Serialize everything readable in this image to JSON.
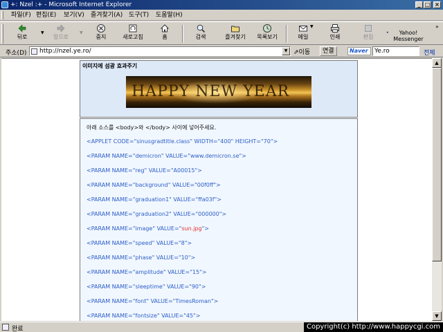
{
  "window": {
    "title": "+: Nzel :+ - Microsoft Internet Explorer",
    "controls": [
      "_",
      "□",
      "×"
    ]
  },
  "menu": [
    "파일(F)",
    "편집(E)",
    "보기(V)",
    "즐겨찾기(A)",
    "도구(T)",
    "도움말(H)"
  ],
  "toolbar": {
    "back": "뒤로",
    "forward": "앞으로",
    "stop": "중지",
    "refresh": "새로고침",
    "home": "홈",
    "search": "검색",
    "favorites": "즐겨찾기",
    "history": "목록보기",
    "mail": "메일",
    "print": "인쇄",
    "edit": "편집",
    "messenger": "Yahoo! Messenger"
  },
  "address": {
    "label": "주소(D)",
    "url": "http://nzel.ye.ro/",
    "go": "이동",
    "links": "연결"
  },
  "naver": {
    "logo": "Naver",
    "search_value": "Ye.ro",
    "button": "전체"
  },
  "page": {
    "card1_heading": "이미지에 섬광 효과주기",
    "banner_text": "HAPPY NEW YEAR",
    "intro": "아래 소스를 <body>와 </body> 사이에 넣어주세요.",
    "code_lines": [
      {
        "pre": "<APPLET CODE=\"sinusgradtitle.class\" WIDTH=\"400\" HEIGHT=\"70\">",
        "hl": "",
        "post": ""
      },
      {
        "pre": "<PARAM NAME=\"demicron\" VALUE=\"www.demicron.se\">",
        "hl": "",
        "post": ""
      },
      {
        "pre": "<PARAM NAME=\"reg\" VALUE=\"A00015\">",
        "hl": "",
        "post": ""
      },
      {
        "pre": "<PARAM NAME=\"background\" VALUE=\"00f0ff\">",
        "hl": "",
        "post": ""
      },
      {
        "pre": "<PARAM NAME=\"graduation1\" VALUE=\"ffa03f\">",
        "hl": "",
        "post": ""
      },
      {
        "pre": "<PARAM NAME=\"graduation2\" VALUE=\"000000\">",
        "hl": "",
        "post": ""
      },
      {
        "pre": "<PARAM NAME=\"image\" VALUE=\"",
        "hl": "sun.jpg",
        "post": "\">"
      },
      {
        "pre": "<PARAM NAME=\"speed\" VALUE=\"8\">",
        "hl": "",
        "post": ""
      },
      {
        "pre": "<PARAM NAME=\"phase\" VALUE=\"10\">",
        "hl": "",
        "post": ""
      },
      {
        "pre": "<PARAM NAME=\"amplitude\" VALUE=\"15\">",
        "hl": "",
        "post": ""
      },
      {
        "pre": "<PARAM NAME=\"sleeptime\" VALUE=\"90\">",
        "hl": "",
        "post": ""
      },
      {
        "pre": "<PARAM NAME=\"font\" VALUE=\"TimesRoman\">",
        "hl": "",
        "post": ""
      },
      {
        "pre": "<PARAM NAME=\"fontsize\" VALUE=\"45\">",
        "hl": "",
        "post": ""
      }
    ]
  },
  "status": {
    "text": "완료",
    "copyright": "Copyright(c) http://www.happycgi.com"
  }
}
